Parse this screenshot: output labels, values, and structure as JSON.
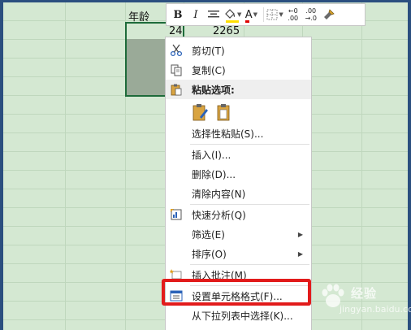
{
  "sheet": {
    "header_age": "年龄",
    "value_age": "24",
    "value_other": "2265"
  },
  "mini_toolbar": {
    "bold": "B",
    "italic": "I",
    "font_color_letter": "A",
    "increase_decimal_top": "←0",
    "increase_decimal_bottom": ".00",
    "decrease_decimal_top": ".00",
    "decrease_decimal_bottom": "→.0",
    "highlight_color": "#ffe000",
    "font_color": "#e00000"
  },
  "context_menu": {
    "items": [
      {
        "label": "剪切(T)",
        "icon": "scissors-icon"
      },
      {
        "label": "复制(C)",
        "icon": "copy-icon"
      },
      {
        "label": "粘贴选项:",
        "icon": "paste-icon"
      },
      {
        "label": "选择性粘贴(S)...",
        "icon": ""
      },
      {
        "label": "插入(I)...",
        "icon": ""
      },
      {
        "label": "删除(D)...",
        "icon": ""
      },
      {
        "label": "清除内容(N)",
        "icon": ""
      },
      {
        "label": "快速分析(Q)",
        "icon": "quick-analysis-icon"
      },
      {
        "label": "筛选(E)",
        "icon": ""
      },
      {
        "label": "排序(O)",
        "icon": ""
      },
      {
        "label": "插入批注(M)",
        "icon": "insert-comment-icon"
      },
      {
        "label": "设置单元格格式(F)...",
        "icon": "format-cells-icon"
      },
      {
        "label": "从下拉列表中选择(K)...",
        "icon": ""
      }
    ]
  },
  "watermark": {
    "text": "经验",
    "url": "jingyan.baidu.com"
  },
  "colors": {
    "sheet_background": "#d4e8d2",
    "selection_border": "#1e6b3a",
    "highlight_border": "#e21b1b"
  }
}
